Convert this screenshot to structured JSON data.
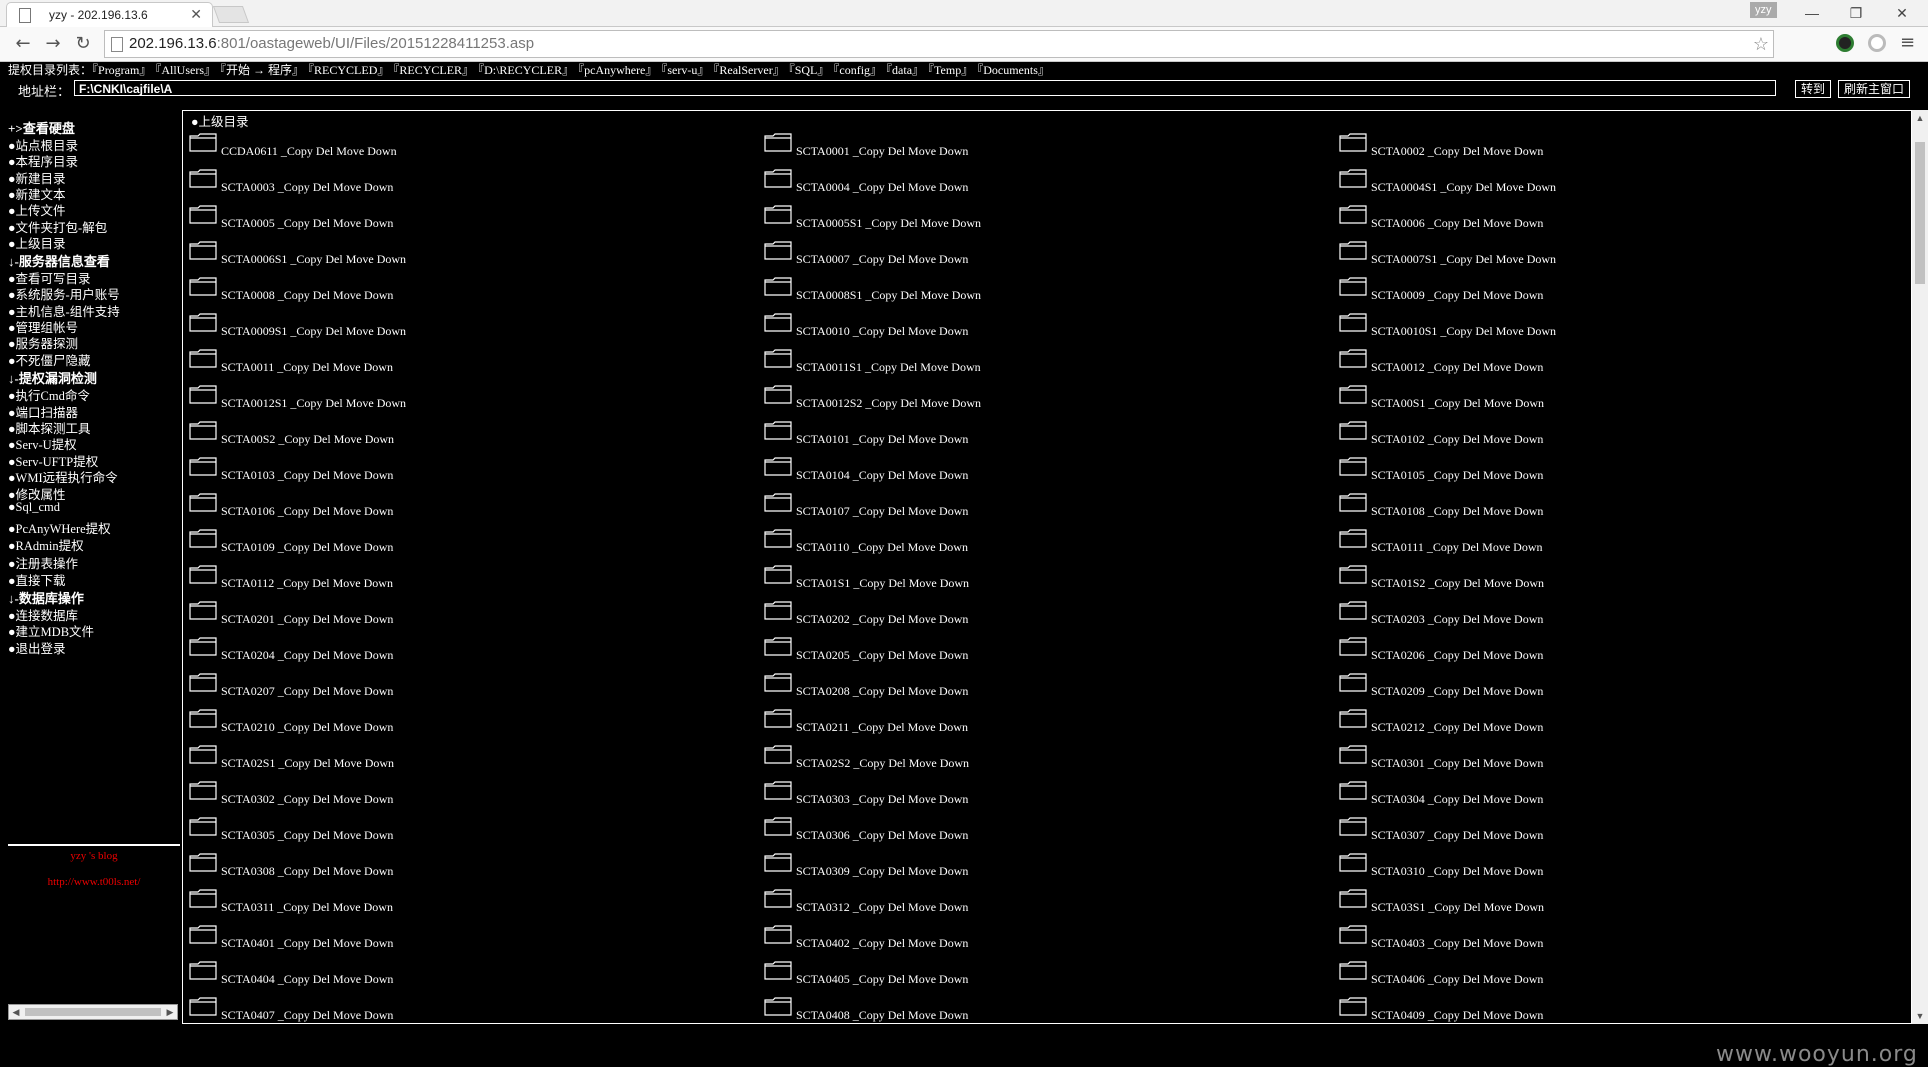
{
  "browser": {
    "tab_title": "yzy - 202.196.13.6",
    "profile_name": "yzy",
    "url_host": "202.196.13.6",
    "url_path": ":801/oastageweb/UI/Files/20151228411253.asp"
  },
  "toolbar": {
    "quick_label": "提权目录列表：",
    "quick_links": [
      "『Program』",
      "『AllUsers』",
      "『开始 → 程序』",
      "『RECYCLED』",
      "『RECYCLER』",
      "『D:\\RECYCLER』",
      "『pcAnywhere』",
      "『serv-u』",
      "『RealServer』",
      "『SQL』",
      "『config』",
      "『data』",
      "『Temp』",
      "『Documents』"
    ],
    "address_label": "地址栏：",
    "address_value": "F:\\CNKI\\cajfile\\A",
    "goto_button": "转到",
    "refresh_button": "刷新主窗口"
  },
  "sidebar": {
    "items": [
      {
        "label": "+>查看硬盘",
        "section": true
      },
      {
        "label": "●站点根目录",
        "section": false
      },
      {
        "label": "●本程序目录",
        "section": false
      },
      {
        "label": "●新建目录",
        "section": false
      },
      {
        "label": "●新建文本",
        "section": false
      },
      {
        "label": "●上传文件",
        "section": false
      },
      {
        "label": "●文件夹打包-解包",
        "section": false
      },
      {
        "label": "●上级目录",
        "section": false
      },
      {
        "label": "↓-服务器信息查看",
        "section": true
      },
      {
        "label": "●查看可写目录",
        "section": false
      },
      {
        "label": "●系统服务-用户账号",
        "section": false
      },
      {
        "label": "●主机信息-组件支持",
        "section": false
      },
      {
        "label": "●管理组帐号",
        "section": false
      },
      {
        "label": "●服务器探测",
        "section": false
      },
      {
        "label": "●不死僵尸隐藏",
        "section": false
      },
      {
        "label": "↓-提权漏洞检测",
        "section": true
      },
      {
        "label": "●执行Cmd命令",
        "section": false
      },
      {
        "label": "●端口扫描器",
        "section": false
      },
      {
        "label": "●脚本探测工具",
        "section": false
      },
      {
        "label": "●Serv-U提权",
        "section": false
      },
      {
        "label": "●Serv-UFTP提权",
        "section": false
      },
      {
        "label": "●WMI远程执行命令",
        "section": false
      },
      {
        "label": "●修改属性",
        "section": false
      },
      {
        "label": "●Sql_cmd",
        "section": false
      },
      {
        "label": "●PcAnyWHere提权",
        "section": false
      },
      {
        "label": "●RAdmin提权",
        "section": false
      },
      {
        "label": "●注册表操作",
        "section": false
      },
      {
        "label": "●直接下载",
        "section": false
      },
      {
        "label": "↓-数据库操作",
        "section": true
      },
      {
        "label": "●连接数据库",
        "section": false
      },
      {
        "label": "●建立MDB文件",
        "section": false
      },
      {
        "label": "●退出登录",
        "section": false
      }
    ],
    "blog_label": "yzy 's blog",
    "blog_url": "http://www.t00ls.net/"
  },
  "main": {
    "parent_dir": "●上级目录",
    "actions": "_Copy Del Move Down",
    "folders": [
      "CCDA0611",
      "SCTA0001",
      "SCTA0002",
      "SCTA0003",
      "SCTA0004",
      "SCTA0004S1",
      "SCTA0005",
      "SCTA0005S1",
      "SCTA0006",
      "SCTA0006S1",
      "SCTA0007",
      "SCTA0007S1",
      "SCTA0008",
      "SCTA0008S1",
      "SCTA0009",
      "SCTA0009S1",
      "SCTA0010",
      "SCTA0010S1",
      "SCTA0011",
      "SCTA0011S1",
      "SCTA0012",
      "SCTA0012S1",
      "SCTA0012S2",
      "SCTA00S1",
      "SCTA00S2",
      "SCTA0101",
      "SCTA0102",
      "SCTA0103",
      "SCTA0104",
      "SCTA0105",
      "SCTA0106",
      "SCTA0107",
      "SCTA0108",
      "SCTA0109",
      "SCTA0110",
      "SCTA0111",
      "SCTA0112",
      "SCTA01S1",
      "SCTA01S2",
      "SCTA0201",
      "SCTA0202",
      "SCTA0203",
      "SCTA0204",
      "SCTA0205",
      "SCTA0206",
      "SCTA0207",
      "SCTA0208",
      "SCTA0209",
      "SCTA0210",
      "SCTA0211",
      "SCTA0212",
      "SCTA02S1",
      "SCTA02S2",
      "SCTA0301",
      "SCTA0302",
      "SCTA0303",
      "SCTA0304",
      "SCTA0305",
      "SCTA0306",
      "SCTA0307",
      "SCTA0308",
      "SCTA0309",
      "SCTA0310",
      "SCTA0311",
      "SCTA0312",
      "SCTA03S1",
      "SCTA0401",
      "SCTA0402",
      "SCTA0403",
      "SCTA0404",
      "SCTA0405",
      "SCTA0406",
      "SCTA0407",
      "SCTA0408",
      "SCTA0409"
    ]
  },
  "watermark": "www.wooyun.org"
}
